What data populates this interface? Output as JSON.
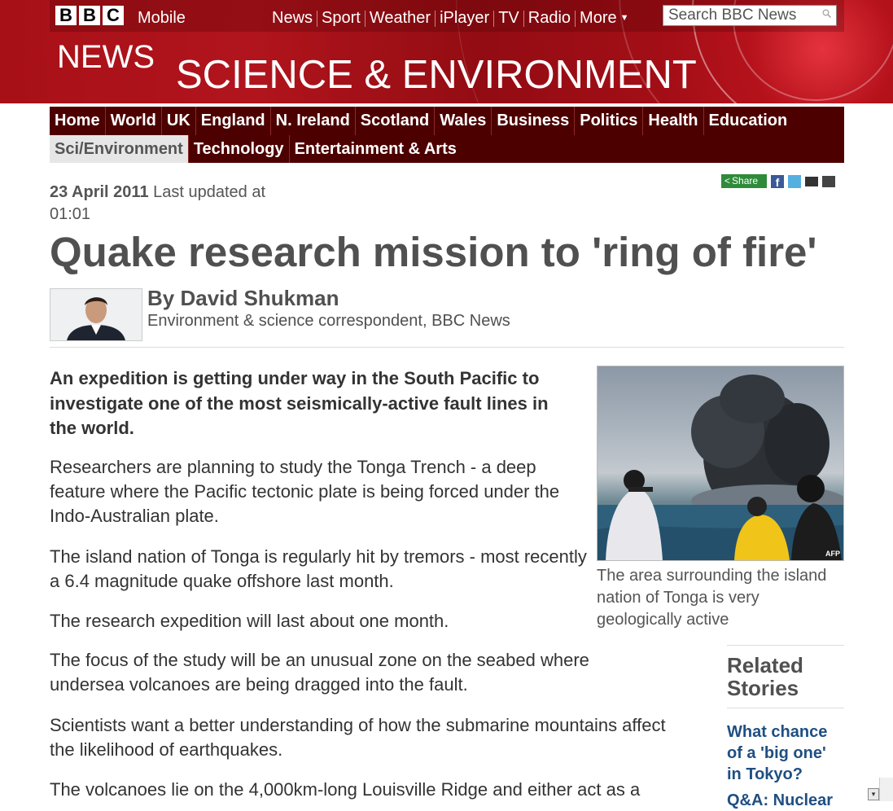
{
  "header": {
    "brand_letters": [
      "B",
      "B",
      "C"
    ],
    "mobile_label": "Mobile",
    "nav": [
      "News",
      "Sport",
      "Weather",
      "iPlayer",
      "TV",
      "Radio",
      "More"
    ],
    "search_placeholder": "Search BBC News",
    "news_word": "NEWS",
    "section_title": "SCIENCE & ENVIRONMENT"
  },
  "section_nav": {
    "row1": [
      "Home",
      "World",
      "UK",
      "England",
      "N. Ireland",
      "Scotland",
      "Wales",
      "Business",
      "Politics",
      "Health",
      "Education"
    ],
    "row2": [
      "Sci/Environment",
      "Technology",
      "Entertainment & Arts"
    ],
    "active": "Sci/Environment"
  },
  "article": {
    "date": "23 April 2011",
    "updated_label": "Last updated at",
    "time": "01:01",
    "share_label": "Share",
    "headline": "Quake research mission to 'ring of fire'",
    "byline_name": "By David Shukman",
    "byline_role": "Environment & science correspondent, BBC News",
    "intro": "An expedition is getting under way in the South Pacific to investigate one of the most seismically-active fault lines in the world.",
    "paragraphs": [
      "Researchers are planning to study the Tonga Trench - a deep feature where the Pacific tectonic plate is being forced under the Indo-Australian plate.",
      "The island nation of Tonga is regularly hit by tremors - most recently a 6.4 magnitude quake offshore last month.",
      "The research expedition will last about one month.",
      "The focus of the study will be an unusual zone on the seabed where undersea volcanoes are being dragged into the fault.",
      "Scientists want a better understanding of how the submarine mountains affect the likelihood of earthquakes.",
      "The volcanoes lie on the 4,000km-long Louisville Ridge and either act as a"
    ],
    "image_credit": "AFP",
    "image_caption": "The area surrounding the island nation of Tonga is very geologically active"
  },
  "related": {
    "heading": "Related Stories",
    "stories": [
      "What chance of a 'big one' in Tokyo?",
      "Q&A: Nuclear"
    ]
  },
  "colors": {
    "masthead_red": "#b5121b",
    "section_nav_bg": "#4d0000",
    "link_blue": "#1f4f82",
    "share_green": "#2e8b3a"
  }
}
